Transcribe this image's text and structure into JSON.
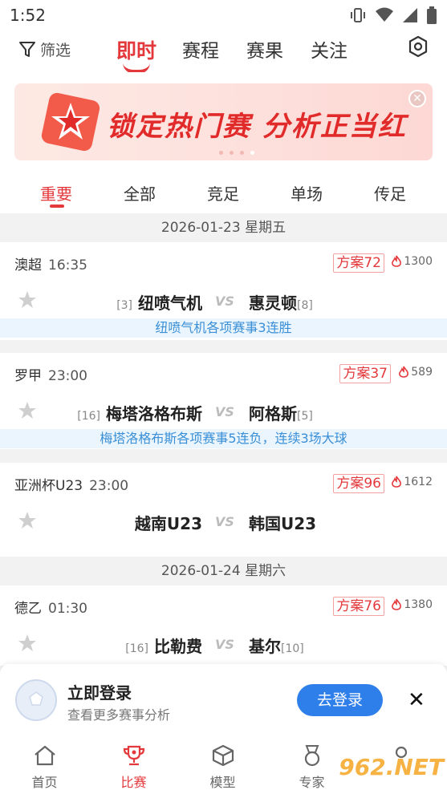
{
  "status": {
    "time": "1:52"
  },
  "nav": {
    "filter_label": "筛选",
    "tabs": [
      "即时",
      "赛程",
      "赛果",
      "关注"
    ]
  },
  "banner": {
    "text": "锁定热门赛 分析正当红"
  },
  "subtabs": [
    "重要",
    "全部",
    "竞足",
    "单场",
    "传足"
  ],
  "dates": [
    "2026-01-23 星期五",
    "2026-01-24 星期六"
  ],
  "matches": [
    {
      "league": "澳超",
      "time": "16:35",
      "plan": "方案72",
      "heat": "1300",
      "home": "纽喷气机",
      "home_rank": "[3]",
      "away": "惠灵顿",
      "away_rank": "[8]",
      "tip": "纽喷气机各项赛事3连胜"
    },
    {
      "league": "罗甲",
      "time": "23:00",
      "plan": "方案37",
      "heat": "589",
      "home": "梅塔洛格布斯",
      "home_rank": "[16]",
      "away": "阿格斯",
      "away_rank": "[5]",
      "tip": "梅塔洛格布斯各项赛事5连负，连续3场大球"
    },
    {
      "league": "亚洲杯U23",
      "time": "23:00",
      "plan": "方案96",
      "heat": "1612",
      "home": "越南U23",
      "home_rank": "",
      "away": "韩国U23",
      "away_rank": "",
      "tip": ""
    },
    {
      "league": "德乙",
      "time": "01:30",
      "plan": "方案76",
      "heat": "1380",
      "home": "比勒费",
      "home_rank": "[16]",
      "away": "基尔",
      "away_rank": "[10]",
      "tip": ""
    }
  ],
  "vs_label": "VS",
  "login": {
    "title": "立即登录",
    "subtitle": "查看更多赛事分析",
    "button": "去登录"
  },
  "bottom_nav": [
    "首页",
    "比赛",
    "模型",
    "专家"
  ],
  "watermark": "962.NET",
  "colors": {
    "accent": "#e4393c",
    "blue": "#2f7fea"
  }
}
